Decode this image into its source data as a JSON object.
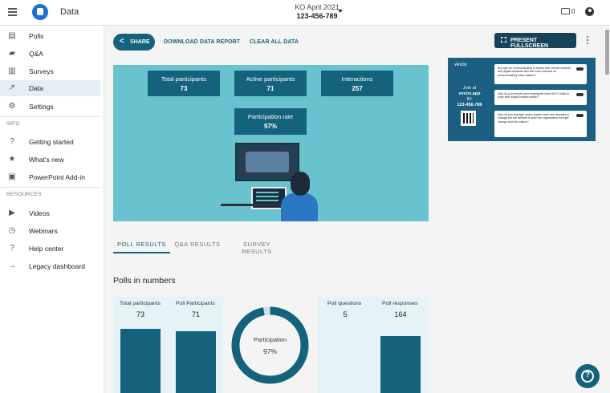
{
  "app": {
    "page_title": "Data"
  },
  "event": {
    "name": "KO April 2021",
    "code": "123-456-789"
  },
  "header": {
    "device_count": "0"
  },
  "sidebar": {
    "items": [
      {
        "label": "Polls",
        "icon": "poll-icon"
      },
      {
        "label": "Q&A",
        "icon": "qa-icon"
      },
      {
        "label": "Surveys",
        "icon": "survey-icon"
      },
      {
        "label": "Data",
        "icon": "trend-icon",
        "active": true
      },
      {
        "label": "Settings",
        "icon": "gear-icon"
      }
    ],
    "info_title": "INFO",
    "info_items": [
      {
        "label": "Getting started",
        "icon": "help-circle-icon"
      },
      {
        "label": "What's new",
        "icon": "star-icon"
      },
      {
        "label": "PowerPoint Add-in",
        "icon": "powerpoint-icon"
      }
    ],
    "resources_title": "RESOURCES",
    "resource_items": [
      {
        "label": "Videos",
        "icon": "video-icon"
      },
      {
        "label": "Webinars",
        "icon": "clock-icon"
      },
      {
        "label": "Help center",
        "icon": "help-circle-icon"
      },
      {
        "label": "Legacy dashboard",
        "icon": "arrow-icon"
      }
    ]
  },
  "toolbar": {
    "share_label": "SHARE",
    "download_label": "DOWNLOAD DATA REPORT",
    "clear_label": "CLEAR ALL DATA",
    "present_label": "PRESENT FULLSCREEN"
  },
  "hero": {
    "total_participants_title": "Total participants",
    "total_participants_value": "73",
    "active_participants_title": "Active participants",
    "active_participants_value": "71",
    "interactions_title": "Interactions",
    "interactions_value": "257",
    "participation_rate_title": "Participation rate",
    "participation_rate_value": "97%"
  },
  "preview": {
    "brand": "vevox",
    "join_text": "Join at",
    "join_site": "vevox.app",
    "id_label": "ID:",
    "id_value": "123-456-789",
    "questions": [
      "Any tips for communicating to teams with remote workers and digital solutions who are more focused on communicating what matters?",
      "How do you ensure your employees have the IT skills to cope with digital transformation?",
      "How do you manage senior leaders who are reluctant to change but are needed to lead the organisation through change and the culture?"
    ]
  },
  "tabs": [
    {
      "label": "POLL RESULTS",
      "active": true
    },
    {
      "label": "Q&A RESULTS",
      "active": false
    },
    {
      "label": "SURVEY RESULTS",
      "active": false
    }
  ],
  "polls": {
    "heading": "Polls in numbers",
    "total_participants_label": "Total participants",
    "total_participants_value": "73",
    "poll_participants_label": "Poll Participants",
    "poll_participants_value": "71",
    "participation_label": "Participation",
    "participation_value": "97%",
    "participation_fraction": 0.97,
    "poll_questions_label": "Poll questions",
    "poll_questions_value": "5",
    "poll_responses_label": "Poll responses",
    "poll_responses_value": "164"
  },
  "colors": {
    "primary": "#14627b",
    "dark": "#16435a",
    "hero_bg": "#69c3ce"
  },
  "help_label": "?"
}
